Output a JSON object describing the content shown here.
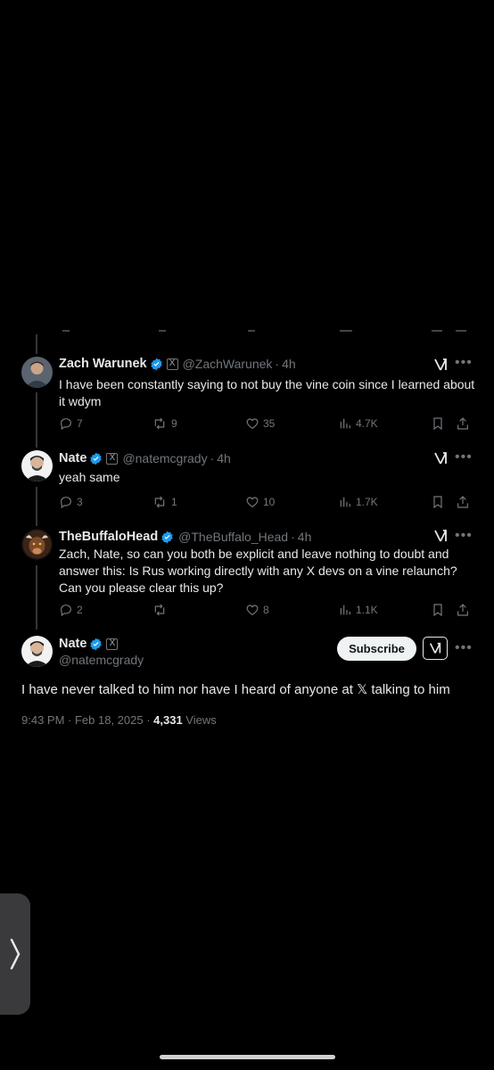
{
  "replies": [
    {
      "name": "Zach Warunek",
      "handle": "@ZachWarunek",
      "time": "4h",
      "text": "I have been constantly saying to not buy the vine coin since I learned about it wdym",
      "replies": "7",
      "reposts": "9",
      "likes": "35",
      "views": "4.7K"
    },
    {
      "name": "Nate",
      "handle": "@natemcgrady",
      "time": "4h",
      "text": "yeah same",
      "replies": "3",
      "reposts": "1",
      "likes": "10",
      "views": "1.7K"
    },
    {
      "name": "TheBuffaloHead",
      "handle": "@TheBuffalo_Head",
      "time": "4h",
      "text": "Zach, Nate, so can you both be explicit and leave nothing to doubt and answer this: Is Rus working directly with any X devs on a vine relaunch? Can you please clear this up?",
      "replies": "2",
      "reposts": "",
      "likes": "8",
      "views": "1.1K"
    }
  ],
  "main": {
    "name": "Nate",
    "handle": "@natemcgrady",
    "subscribe_label": "Subscribe",
    "text": "I have never talked to him nor have I heard of anyone at 𝕏 talking to him",
    "time": "9:43 PM · Feb 18, 2025 · ",
    "views_count": "4,331",
    "views_label": " Views"
  },
  "icons": {
    "reply": "reply-icon",
    "repost": "repost-icon",
    "like": "heart-icon",
    "views": "views-icon",
    "bookmark": "bookmark-icon",
    "share": "share-icon",
    "grok": "grok-icon",
    "verified": "verified-badge-icon",
    "back": "chevron-right-icon"
  },
  "colors": {
    "background": "#000000",
    "text": "#e7e9ea",
    "secondary": "#71767b",
    "verified": "#1d9bf0"
  }
}
